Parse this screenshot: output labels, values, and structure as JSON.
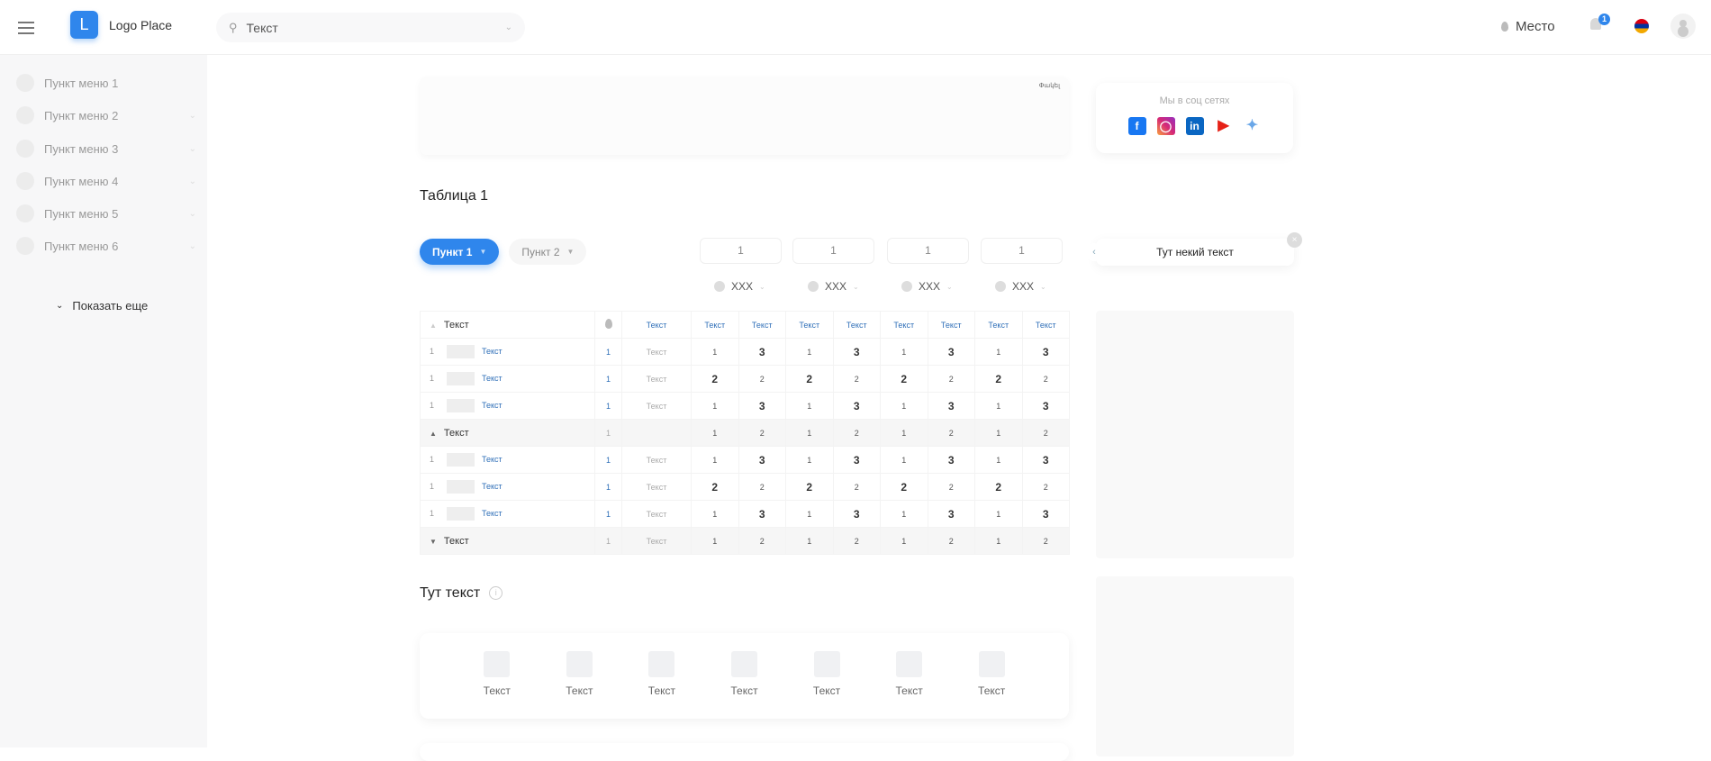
{
  "header": {
    "logo_letter": "L",
    "logo_text": "Logo Place",
    "search_value": "Текст",
    "place": "Место",
    "notifications": "1"
  },
  "sidebar": {
    "items": [
      {
        "label": "Пункт меню 1"
      },
      {
        "label": "Пункт меню 2"
      },
      {
        "label": "Пункт меню 3"
      },
      {
        "label": "Пункт меню 4"
      },
      {
        "label": "Пункт меню 5"
      },
      {
        "label": "Пункт меню 6"
      }
    ],
    "show_more": "Показать еще"
  },
  "top_card": {
    "close_label": "Փակել"
  },
  "social": {
    "title": "Мы в соц сетях",
    "icons": [
      "facebook-icon",
      "instagram-icon",
      "linkedin-icon",
      "youtube-icon",
      "twitter-icon"
    ]
  },
  "table_title": "Таблица 1",
  "tabs": [
    {
      "label": "Пункт 1"
    },
    {
      "label": "Пункт 2"
    }
  ],
  "inputs": [
    "1",
    "1",
    "1",
    "1"
  ],
  "selects": [
    "XXX",
    "XXX",
    "XXX",
    "XXX"
  ],
  "tooltip": {
    "text": "Тут некий текст"
  },
  "table": {
    "header": {
      "name": "Текст",
      "col3": "Текст",
      "cols": [
        "Текст",
        "Текст",
        "Текст",
        "Текст",
        "Текст",
        "Текст",
        "Текст",
        "Текст"
      ]
    },
    "rows": [
      {
        "type": "item",
        "idx": "1",
        "name": "Текст",
        "n": "1",
        "col3": "Текст",
        "values": [
          "1",
          "3",
          "1",
          "3",
          "1",
          "3",
          "1",
          "3"
        ],
        "emph": "odd"
      },
      {
        "type": "item",
        "idx": "1",
        "name": "Текст",
        "n": "1",
        "col3": "Текст",
        "values": [
          "2",
          "2",
          "2",
          "2",
          "2",
          "2",
          "2",
          "2"
        ],
        "emph": "even"
      },
      {
        "type": "item",
        "idx": "1",
        "name": "Текст",
        "n": "1",
        "col3": "Текст",
        "values": [
          "1",
          "3",
          "1",
          "3",
          "1",
          "3",
          "1",
          "3"
        ],
        "emph": "odd"
      },
      {
        "type": "group",
        "arrow": "up",
        "name": "Текст",
        "n": "1",
        "col3": "",
        "values": [
          "1",
          "2",
          "1",
          "2",
          "1",
          "2",
          "1",
          "2"
        ]
      },
      {
        "type": "item",
        "idx": "1",
        "name": "Текст",
        "n": "1",
        "col3": "Текст",
        "values": [
          "1",
          "3",
          "1",
          "3",
          "1",
          "3",
          "1",
          "3"
        ],
        "emph": "odd"
      },
      {
        "type": "item",
        "idx": "1",
        "name": "Текст",
        "n": "1",
        "col3": "Текст",
        "values": [
          "2",
          "2",
          "2",
          "2",
          "2",
          "2",
          "2",
          "2"
        ],
        "emph": "even"
      },
      {
        "type": "item",
        "idx": "1",
        "name": "Текст",
        "n": "1",
        "col3": "Текст",
        "values": [
          "1",
          "3",
          "1",
          "3",
          "1",
          "3",
          "1",
          "3"
        ],
        "emph": "odd"
      },
      {
        "type": "group",
        "arrow": "down",
        "name": "Текст",
        "n": "1",
        "col3": "Текст",
        "values": [
          "1",
          "2",
          "1",
          "2",
          "1",
          "2",
          "1",
          "2"
        ]
      }
    ]
  },
  "section2": {
    "title": "Тут текст",
    "items": [
      "Текст",
      "Текст",
      "Текст",
      "Текст",
      "Текст",
      "Текст",
      "Текст"
    ]
  }
}
